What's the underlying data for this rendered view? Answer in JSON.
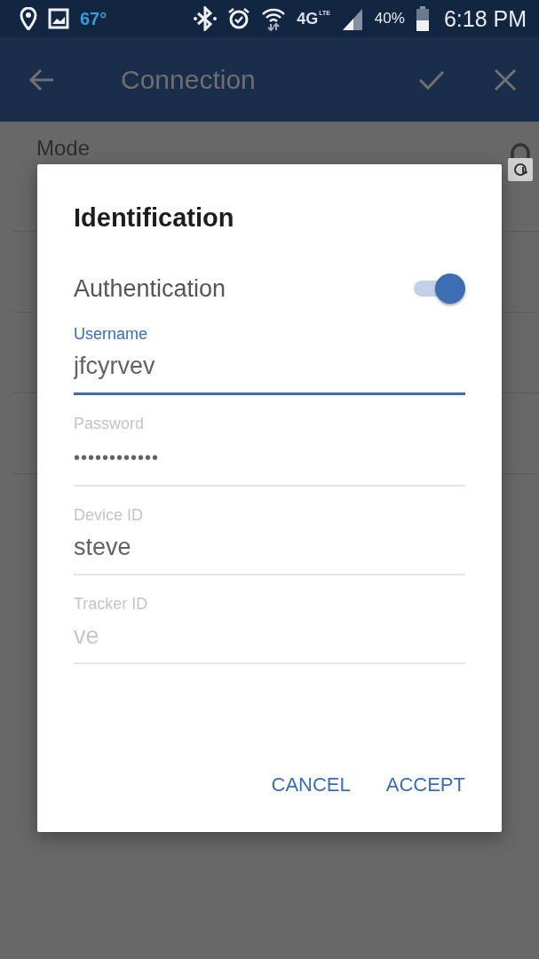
{
  "status_bar": {
    "temperature": "67°",
    "network": "4G",
    "network_sub": "LTE",
    "battery": "40%",
    "time": "6:18 PM"
  },
  "app_bar": {
    "title": "Connection"
  },
  "background": {
    "items": [
      {
        "label": "Mode"
      }
    ]
  },
  "dialog": {
    "title": "Identification",
    "switch": {
      "label": "Authentication",
      "on": true
    },
    "fields": [
      {
        "label": "Username",
        "value": "jfcyrvev",
        "focused": true,
        "kind": "text"
      },
      {
        "label": "Password",
        "value": "••••••••••••",
        "focused": false,
        "kind": "password"
      },
      {
        "label": "Device ID",
        "value": "steve",
        "focused": false,
        "kind": "text"
      },
      {
        "label": "Tracker ID",
        "placeholder": "ve",
        "focused": false,
        "kind": "text"
      }
    ],
    "buttons": [
      "CANCEL",
      "ACCEPT"
    ]
  }
}
